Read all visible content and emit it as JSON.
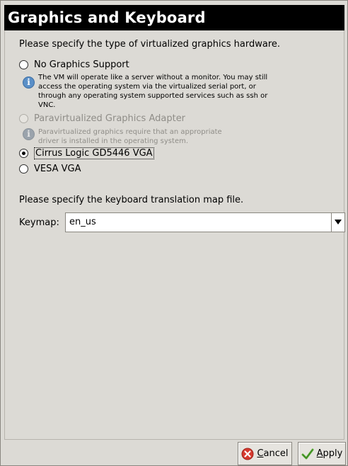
{
  "header": {
    "title": "Graphics and Keyboard"
  },
  "graphics": {
    "prompt": "Please specify the type of virtualized graphics hardware.",
    "options": [
      {
        "label": "No Graphics Support",
        "checked": false,
        "enabled": true,
        "note": "The VM will operate like a server without a monitor.  You may still access the operating system via the virtualized serial port, or through any operating system supported services such as ssh or VNC."
      },
      {
        "label": "Paravirtualized Graphics Adapter",
        "checked": false,
        "enabled": false,
        "note": "Paravirtualized graphics require that an appropriate driver is installed in the operating system."
      },
      {
        "label": "Cirrus Logic GD5446 VGA",
        "checked": true,
        "enabled": true
      },
      {
        "label": "VESA VGA",
        "checked": false,
        "enabled": true
      }
    ]
  },
  "keyboard": {
    "prompt": "Please specify the keyboard translation map file.",
    "keymap_label": "Keymap:",
    "keymap_value": "en_us"
  },
  "buttons": {
    "cancel_prefix": "",
    "cancel_mnemonic": "C",
    "cancel_rest": "ancel",
    "apply_prefix": "",
    "apply_mnemonic": "A",
    "apply_rest": "pply"
  },
  "colors": {
    "header_bg": "#000000",
    "header_fg": "#ffffff",
    "window_bg": "#dcdad5",
    "info_icon": "#5a8fc7",
    "cancel_icon": "#d63a2f",
    "apply_icon": "#5fae3a"
  },
  "icons": {
    "info": "info-icon",
    "cancel": "cancel-x-icon",
    "apply": "checkmark-icon",
    "dropdown": "chevron-down-icon"
  }
}
